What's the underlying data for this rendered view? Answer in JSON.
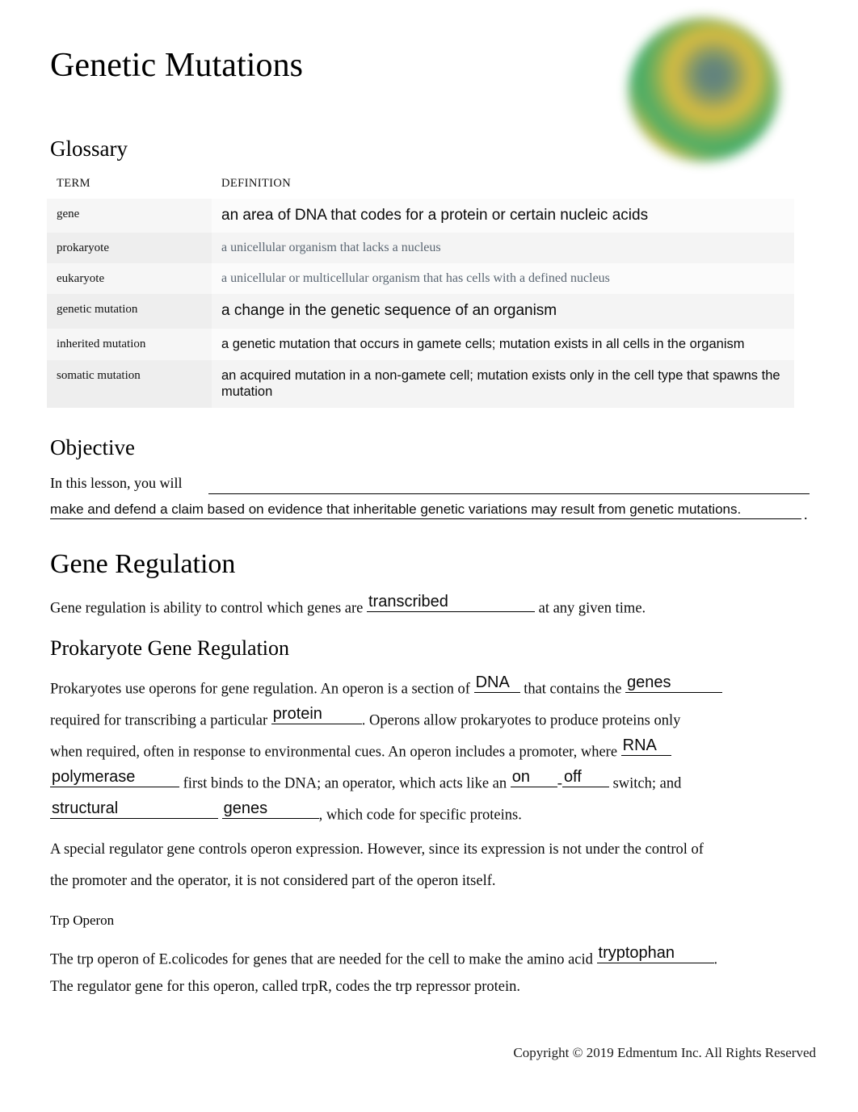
{
  "document": {
    "title": "Genetic Mutations",
    "header_image": "cell-division-illustration"
  },
  "glossary": {
    "heading": "Glossary",
    "columns": [
      "TERM",
      "DEFINITION"
    ],
    "rows": [
      {
        "term": "gene",
        "definition": "an area of DNA that codes for a protein or certain nucleic acids",
        "style": "answer-large"
      },
      {
        "term": "prokaryote",
        "definition": "a unicellular organism that lacks a nucleus",
        "style": "printed"
      },
      {
        "term": "eukaryote",
        "definition": "a unicellular or multicellular organism that has cells with a defined nucleus",
        "style": "printed"
      },
      {
        "term": "genetic mutation",
        "definition": "a change in the genetic sequence of an organism",
        "style": "answer-large"
      },
      {
        "term": "inherited mutation",
        "definition": "a genetic mutation that occurs in gamete cells; mutation exists in all cells in the organism",
        "style": "answer-small"
      },
      {
        "term": "somatic mutation",
        "definition": "an acquired mutation in a non-gamete cell; mutation exists only in the cell type that spawns the mutation",
        "style": "answer-small"
      }
    ]
  },
  "objective": {
    "heading": "Objective",
    "prompt": "In this lesson, you will",
    "answer": "make and defend a claim based on evidence that inheritable genetic variations may result from genetic mutations.",
    "trailing_period": "."
  },
  "gene_regulation": {
    "heading": "Gene Regulation",
    "sentence_before": "Gene regulation is ability to control which genes are",
    "answer": "transcribed",
    "sentence_after": "at any given time."
  },
  "prokaryote_section": {
    "heading": "Prokaryote Gene Regulation",
    "line1_a": "Prokaryotes use operons for gene regulation. An operon is a section of",
    "answer_dna": "DNA",
    "line1_b": "that contains the",
    "answer_genes1": "genes",
    "line2_a": "required for transcribing a particular",
    "answer_protein": "protein",
    "line2_b": ". Operons allow prokaryotes to produce proteins only",
    "line3_a": "when required, often in response to environmental cues. An operon includes a promoter, where",
    "answer_rna": "RNA",
    "answer_polymerase": "polymerase",
    "line4_a": "first binds to the DNA; an operator, which acts like an",
    "answer_on": "on",
    "dash": "-",
    "answer_off": "off",
    "line4_b": "switch; and",
    "answer_structural": "structural",
    "answer_genes2": "genes",
    "line5_b": ", which code for specific proteins.",
    "paragraph2_line1": "A special regulator gene controls operon expression. However, since its expression is not under the control of",
    "paragraph2_line2": "the promoter and the operator, it is not considered part of the operon itself."
  },
  "trp_operon": {
    "heading": "Trp Operon",
    "line1_a": "The trp operon of  E.colicodes for genes that are needed for the cell to make the amino acid",
    "answer_tryptophan": "tryptophan",
    "line1_b": ".",
    "line2": "The regulator gene for this operon, called  trpR, codes the  trp repressor protein."
  },
  "footer": {
    "copyright": "Copyright © 2019 Edmentum Inc. All Rights Reserved"
  }
}
